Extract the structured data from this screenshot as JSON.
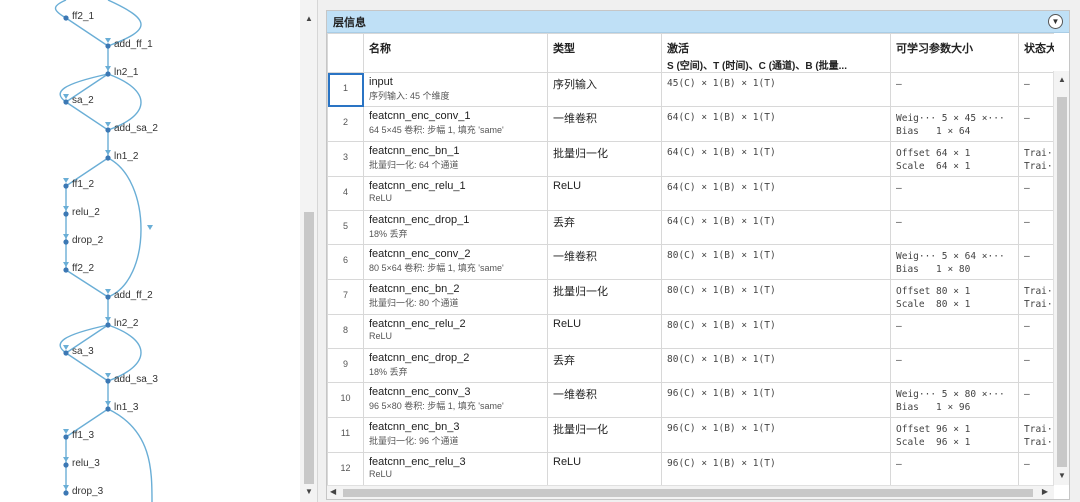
{
  "graph": {
    "nodes": [
      {
        "label": "ff2_1"
      },
      {
        "label": "add_ff_1"
      },
      {
        "label": "ln2_1"
      },
      {
        "label": "sa_2"
      },
      {
        "label": "add_sa_2"
      },
      {
        "label": "ln1_2"
      },
      {
        "label": "ff1_2"
      },
      {
        "label": "relu_2"
      },
      {
        "label": "drop_2"
      },
      {
        "label": "ff2_2"
      },
      {
        "label": "add_ff_2"
      },
      {
        "label": "ln2_2"
      },
      {
        "label": "sa_3"
      },
      {
        "label": "add_sa_3"
      },
      {
        "label": "ln1_3"
      },
      {
        "label": "ff1_3"
      },
      {
        "label": "relu_3"
      },
      {
        "label": "drop_3"
      }
    ],
    "node_color": "#3c78b4",
    "edge_color": "#6aaed6"
  },
  "panel": {
    "title": "层信息",
    "collapse_icon": "chevron-down-circle-icon"
  },
  "table": {
    "headers": {
      "name": "名称",
      "type": "类型",
      "activation": "激活",
      "activation_sub": "S (空间)、T (时间)、C (通道)、B (批量...",
      "learnables": "可学习参数大小",
      "state": "状态大"
    },
    "rows": [
      {
        "idx": "1",
        "name": "input",
        "desc": "序列输入: 45 个维度",
        "type": "序列输入",
        "act": "45(C) × 1(B) × 1(T)",
        "learn": [
          "–"
        ],
        "state": [
          "–"
        ]
      },
      {
        "idx": "2",
        "name": "featcnn_enc_conv_1",
        "desc": "64 5×45 卷积: 步幅 1, 填充 'same'",
        "type": "一维卷积",
        "act": "64(C) × 1(B) × 1(T)",
        "learn": [
          "Weig··· 5 × 45 ×···",
          "Bias   1 × 64"
        ],
        "state": [
          "–"
        ]
      },
      {
        "idx": "3",
        "name": "featcnn_enc_bn_1",
        "desc": "批量归一化: 64 个通道",
        "type": "批量归一化",
        "act": "64(C) × 1(B) × 1(T)",
        "learn": [
          "Offset 64 × 1",
          "Scale  64 × 1"
        ],
        "state": [
          "Trai···",
          "Trai···"
        ]
      },
      {
        "idx": "4",
        "name": "featcnn_enc_relu_1",
        "desc": "ReLU",
        "type": "ReLU",
        "act": "64(C) × 1(B) × 1(T)",
        "learn": [
          "–"
        ],
        "state": [
          "–"
        ]
      },
      {
        "idx": "5",
        "name": "featcnn_enc_drop_1",
        "desc": "18% 丢弃",
        "type": "丢弃",
        "act": "64(C) × 1(B) × 1(T)",
        "learn": [
          "–"
        ],
        "state": [
          "–"
        ]
      },
      {
        "idx": "6",
        "name": "featcnn_enc_conv_2",
        "desc": "80 5×64 卷积: 步幅 1, 填充 'same'",
        "type": "一维卷积",
        "act": "80(C) × 1(B) × 1(T)",
        "learn": [
          "Weig··· 5 × 64 ×···",
          "Bias   1 × 80"
        ],
        "state": [
          "–"
        ]
      },
      {
        "idx": "7",
        "name": "featcnn_enc_bn_2",
        "desc": "批量归一化: 80 个通道",
        "type": "批量归一化",
        "act": "80(C) × 1(B) × 1(T)",
        "learn": [
          "Offset 80 × 1",
          "Scale  80 × 1"
        ],
        "state": [
          "Trai···",
          "Trai···"
        ]
      },
      {
        "idx": "8",
        "name": "featcnn_enc_relu_2",
        "desc": "ReLU",
        "type": "ReLU",
        "act": "80(C) × 1(B) × 1(T)",
        "learn": [
          "–"
        ],
        "state": [
          "–"
        ]
      },
      {
        "idx": "9",
        "name": "featcnn_enc_drop_2",
        "desc": "18% 丢弃",
        "type": "丢弃",
        "act": "80(C) × 1(B) × 1(T)",
        "learn": [
          "–"
        ],
        "state": [
          "–"
        ]
      },
      {
        "idx": "10",
        "name": "featcnn_enc_conv_3",
        "desc": "96 5×80 卷积: 步幅 1, 填充 'same'",
        "type": "一维卷积",
        "act": "96(C) × 1(B) × 1(T)",
        "learn": [
          "Weig··· 5 × 80 ×···",
          "Bias   1 × 96"
        ],
        "state": [
          "–"
        ]
      },
      {
        "idx": "11",
        "name": "featcnn_enc_bn_3",
        "desc": "批量归一化: 96 个通道",
        "type": "批量归一化",
        "act": "96(C) × 1(B) × 1(T)",
        "learn": [
          "Offset 96 × 1",
          "Scale  96 × 1"
        ],
        "state": [
          "Trai···",
          "Trai···"
        ]
      },
      {
        "idx": "12",
        "name": "featcnn_enc_relu_3",
        "desc": "ReLU",
        "type": "ReLU",
        "act": "96(C) × 1(B) × 1(T)",
        "learn": [
          "–"
        ],
        "state": [
          "–"
        ]
      }
    ]
  }
}
